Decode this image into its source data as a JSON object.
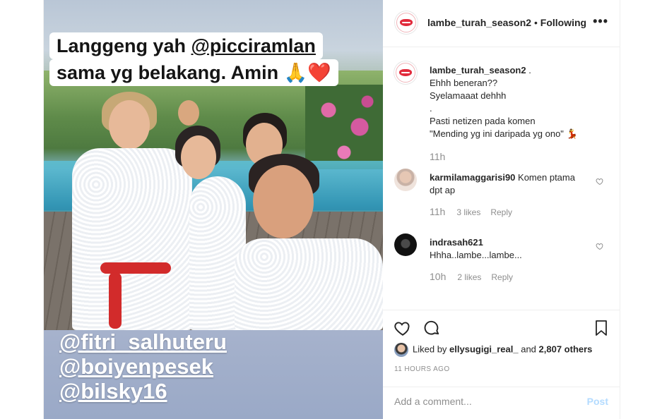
{
  "story": {
    "caption_line1_prefix": "Langgeng yah ",
    "caption_line1_mention": "@picciramlan",
    "caption_line2": "sama yg belakang. Amin 🙏❤️",
    "mentions": [
      "@fitri_salhuteru",
      "@boiyenpesek",
      "@bilsky16"
    ]
  },
  "header": {
    "username": "lambe_turah_season2",
    "separator": " • ",
    "follow_status": "Following",
    "more_label": "•••"
  },
  "caption": {
    "username": "lambe_turah_season2",
    "text_lines": [
      " .",
      "Ehhh beneran??",
      "Syelamaaat dehhh",
      ".",
      "Pasti netizen pada komen",
      "\"Mending yg ini daripada yg ono\" 💃"
    ],
    "time": "11h"
  },
  "comments": [
    {
      "username": "karmilamaggarisi90",
      "text": "Komen ptama dpt ap",
      "time": "11h",
      "likes": "3 likes",
      "reply": "Reply"
    },
    {
      "username": "indrasah621",
      "text": "Hhha..lambe...lambe...",
      "time": "10h",
      "likes": "2 likes",
      "reply": "Reply"
    }
  ],
  "likes": {
    "prefix": "Liked by ",
    "user": "ellysugigi_real_",
    "middle": " and ",
    "count": "2,807 others"
  },
  "timestamp": "11 HOURS AGO",
  "add_comment": {
    "placeholder": "Add a comment...",
    "post_label": "Post"
  },
  "colors": {
    "accent": "#e12b3c",
    "link": "#b3dbff",
    "muted": "#8e8e8e"
  },
  "icons": [
    "heart-icon",
    "comment-icon",
    "bookmark-icon",
    "more-icon"
  ]
}
